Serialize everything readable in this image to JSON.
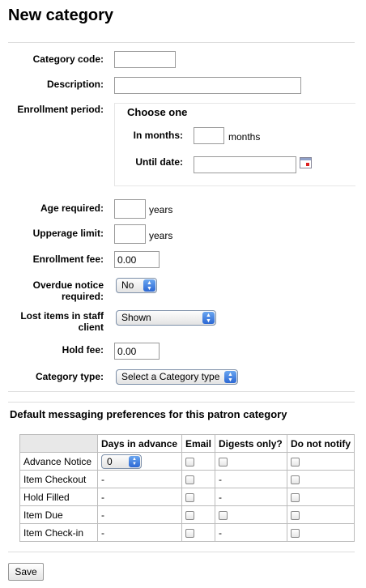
{
  "page": {
    "title": "New category"
  },
  "form": {
    "category_code": {
      "label": "Category code:",
      "value": ""
    },
    "description": {
      "label": "Description:",
      "value": ""
    },
    "enrollment_period": {
      "label": "Enrollment period:",
      "legend": "Choose one",
      "in_months_label": "In months:",
      "in_months_value": "",
      "months_unit": "months",
      "until_date_label": "Until date:",
      "until_date_value": ""
    },
    "age_required": {
      "label": "Age required:",
      "value": "",
      "unit": "years"
    },
    "upperage_limit": {
      "label": "Upperage limit:",
      "value": "",
      "unit": "years"
    },
    "enrollment_fee": {
      "label": "Enrollment fee:",
      "value": "0.00"
    },
    "overdue_notice": {
      "label_line1": "Overdue notice",
      "label_line2": "required:",
      "selected": "No"
    },
    "lost_items": {
      "label_line1": "Lost items in staff",
      "label_line2": "client",
      "selected": "Shown"
    },
    "hold_fee": {
      "label": "Hold fee:",
      "value": "0.00"
    },
    "category_type": {
      "label": "Category type:",
      "selected": "Select a Category type"
    }
  },
  "messaging": {
    "title": "Default messaging preferences for this patron category",
    "columns": [
      "",
      "Days in advance",
      "Email",
      "Digests only?",
      "Do not notify"
    ],
    "rows": [
      {
        "name": "Advance Notice",
        "days": "0",
        "days_is_select": true,
        "digest": "checkbox"
      },
      {
        "name": "Item Checkout",
        "days": "-",
        "digest": "-"
      },
      {
        "name": "Hold Filled",
        "days": "-",
        "digest": "-"
      },
      {
        "name": "Item Due",
        "days": "-",
        "digest": "checkbox"
      },
      {
        "name": "Item Check-in",
        "days": "-",
        "digest": "-"
      }
    ]
  },
  "actions": {
    "save_label": "Save"
  },
  "icons": {
    "calendar": "calendar-icon",
    "select_arrows": "updown-arrows-icon"
  }
}
